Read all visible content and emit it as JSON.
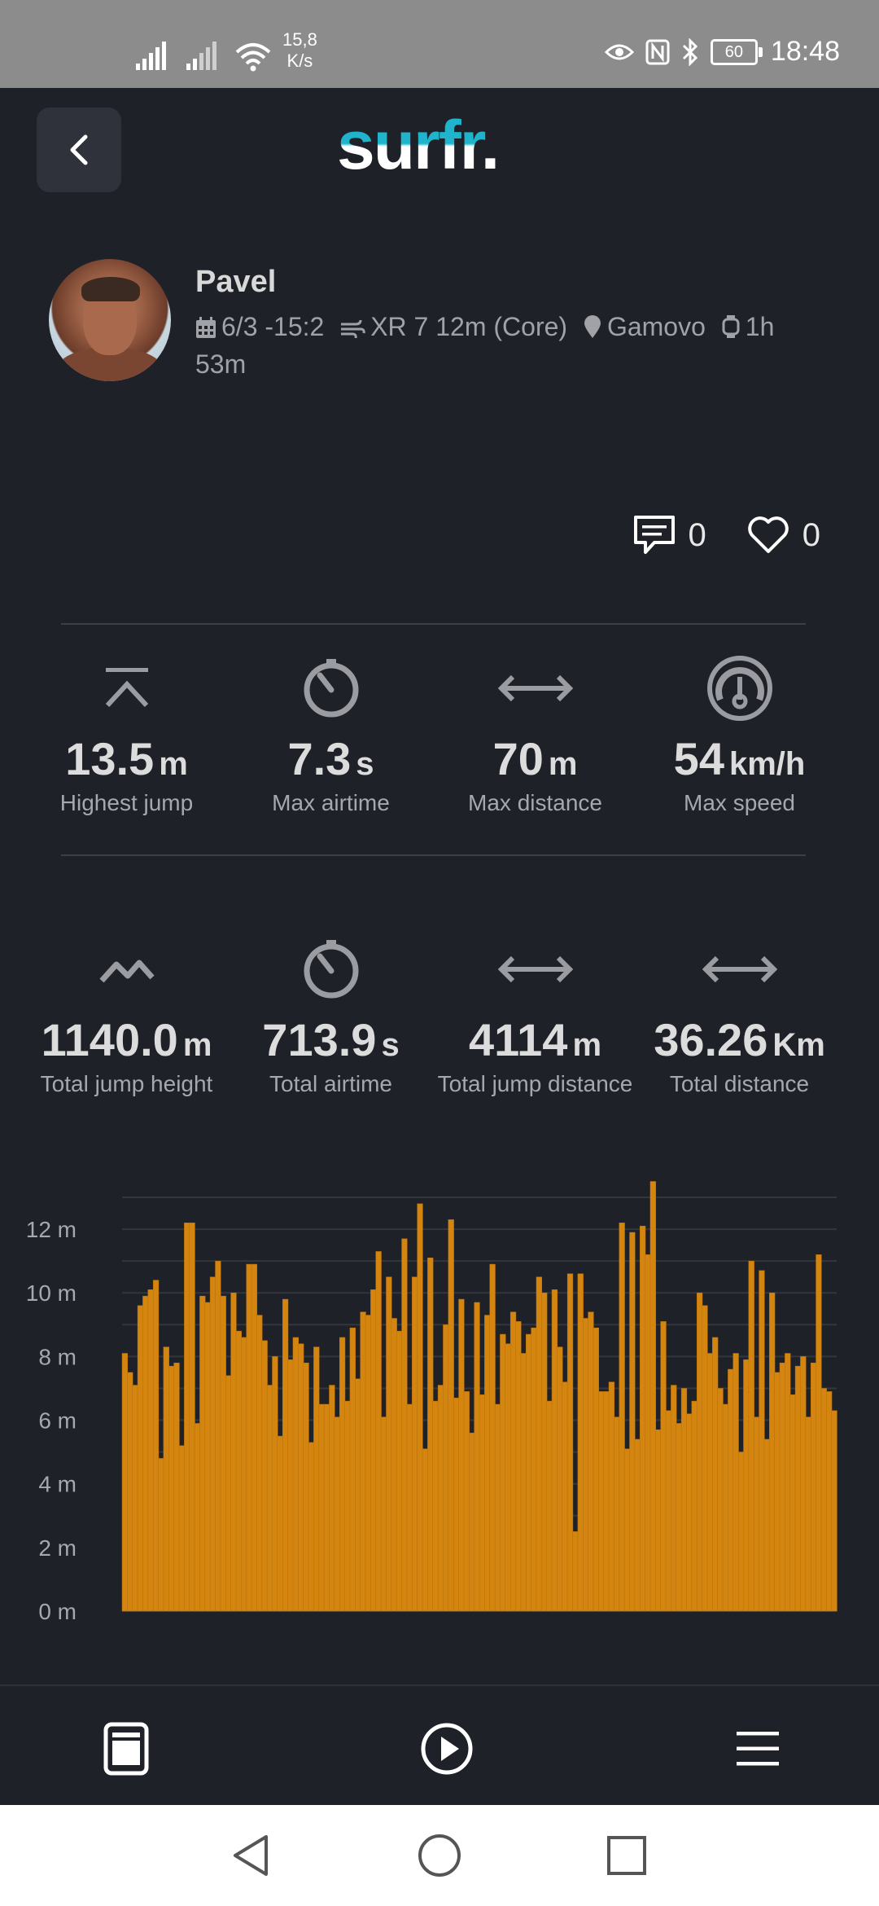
{
  "status_bar": {
    "net_speed_value": "15,8",
    "net_speed_unit": "K/s",
    "battery": "60",
    "time": "18:48"
  },
  "header": {
    "logo_text": "surfr",
    "logo_dot": "."
  },
  "profile": {
    "name": "Pavel",
    "date": "6/3 -15:2",
    "kite": "XR 7 12m (Core)",
    "location": "Gamovo",
    "duration": "1h 53m"
  },
  "social": {
    "comments": "0",
    "likes": "0"
  },
  "stats_top": [
    {
      "icon": "highest-jump-icon",
      "value": "13.5",
      "unit": "m",
      "label": "Highest jump"
    },
    {
      "icon": "timer-icon",
      "value": "7.3",
      "unit": "s",
      "label": "Max airtime"
    },
    {
      "icon": "distance-arrows-icon",
      "value": "70",
      "unit": "m",
      "label": "Max distance"
    },
    {
      "icon": "speedometer-icon",
      "value": "54",
      "unit": "km/h",
      "label": "Max speed"
    }
  ],
  "stats_total": [
    {
      "icon": "jump-height-icon",
      "value": "1140.0",
      "unit": "m",
      "label": "Total jump height"
    },
    {
      "icon": "timer-icon",
      "value": "713.9",
      "unit": "s",
      "label": "Total airtime"
    },
    {
      "icon": "distance-arrows-icon",
      "value": "4114",
      "unit": "m",
      "label": "Total jump distance"
    },
    {
      "icon": "distance-arrows-icon",
      "value": "36.26",
      "unit": "Km",
      "label": "Total distance"
    }
  ],
  "chart_data": {
    "type": "bar",
    "title": "",
    "xlabel": "",
    "ylabel": "",
    "ylim": [
      0,
      13
    ],
    "yticks": [
      "0 m",
      "2 m",
      "4 m",
      "6 m",
      "8 m",
      "10 m",
      "12 m"
    ],
    "ytick_values": [
      0,
      2,
      4,
      6,
      8,
      10,
      12
    ],
    "grid": true,
    "color": "#d4850f",
    "values": [
      8.1,
      7.5,
      7.1,
      9.6,
      9.9,
      10.1,
      10.4,
      4.8,
      8.3,
      7.7,
      7.8,
      5.2,
      12.2,
      12.2,
      5.9,
      9.9,
      9.7,
      10.5,
      11.0,
      9.9,
      7.4,
      10.0,
      8.8,
      8.6,
      10.9,
      10.9,
      9.3,
      8.5,
      7.1,
      8.0,
      5.5,
      9.8,
      7.9,
      8.6,
      8.4,
      7.8,
      5.3,
      8.3,
      6.5,
      6.5,
      7.1,
      6.1,
      8.6,
      6.6,
      8.9,
      7.3,
      9.4,
      9.3,
      10.1,
      11.3,
      6.1,
      10.5,
      9.2,
      8.8,
      11.7,
      6.5,
      10.5,
      12.8,
      5.1,
      11.1,
      6.6,
      7.1,
      9.0,
      12.3,
      6.7,
      9.8,
      6.9,
      5.6,
      9.7,
      6.8,
      9.3,
      10.9,
      6.5,
      8.7,
      8.4,
      9.4,
      9.1,
      8.1,
      8.7,
      8.9,
      10.5,
      10.0,
      6.6,
      10.1,
      8.3,
      7.2,
      10.6,
      2.5,
      10.6,
      9.2,
      9.4,
      8.9,
      6.9,
      6.9,
      7.2,
      6.1,
      12.2,
      5.1,
      11.9,
      5.4,
      12.1,
      11.2,
      13.5,
      5.7,
      9.1,
      6.3,
      7.1,
      5.9,
      7.0,
      6.2,
      6.6,
      10.0,
      9.6,
      8.1,
      8.6,
      7.0,
      6.5,
      7.6,
      8.1,
      5.0,
      7.9,
      11.0,
      6.1,
      10.7,
      5.4,
      10.0,
      7.5,
      7.8,
      8.1,
      6.8,
      7.7,
      8.0,
      6.1,
      7.8,
      11.2,
      7.0,
      6.9,
      6.3
    ]
  },
  "bottom_nav": [
    {
      "icon": "tablet-icon"
    },
    {
      "icon": "play-icon"
    },
    {
      "icon": "menu-icon"
    }
  ],
  "system_nav": [
    {
      "icon": "back-triangle-icon"
    },
    {
      "icon": "home-circle-icon"
    },
    {
      "icon": "recents-square-icon"
    }
  ]
}
